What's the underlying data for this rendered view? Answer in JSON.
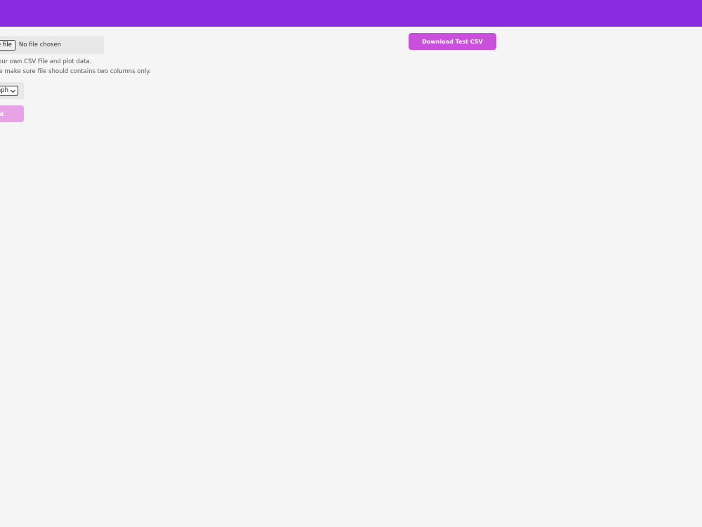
{
  "file_input": {
    "button_label": "e file",
    "status": "No file chosen"
  },
  "help": {
    "line1": "our own CSV File and plot data.",
    "line2": "se make sure file should contains two columns only."
  },
  "graph_select": {
    "selected": "aph",
    "icon": "chevron-down-icon"
  },
  "upload_button": {
    "label": "ad"
  },
  "download_button": {
    "label": "Download Test CSV"
  },
  "colors": {
    "header": "#8a2be2",
    "download": "#c94fdc",
    "upload": "#e7a3e6",
    "background": "#f5f5f5"
  }
}
